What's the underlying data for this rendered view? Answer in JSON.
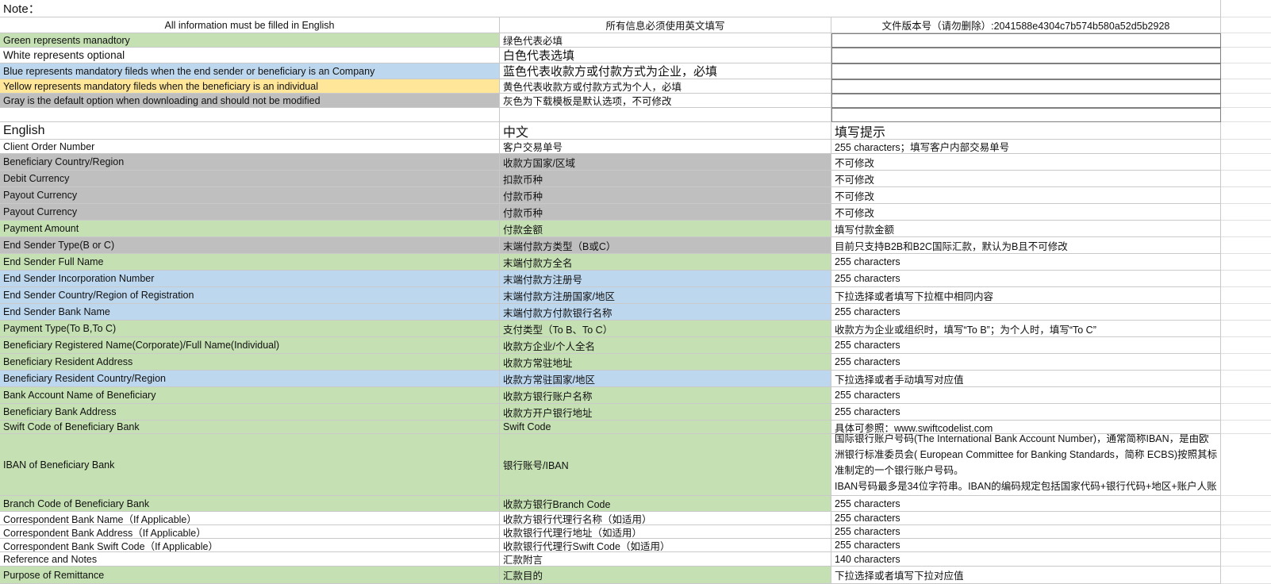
{
  "note": "Note：",
  "header": {
    "english": "All information must be filled in English",
    "chinese": "所有信息必须使用英文填写",
    "version": "文件版本号（请勿删除）:2041588e4304c7b574b580a52d5b2928"
  },
  "legend": [
    {
      "en": "Green represents manadtory",
      "zh": "绿色代表必填"
    },
    {
      "en": "White represents  optional",
      "zh": "白色代表选填"
    },
    {
      "en": "Blue represents mandatory fileds when the end sender or beneficiary is an Company",
      "zh": "蓝色代表收款方或付款方式为企业，必填"
    },
    {
      "en": "Yellow represents mandatory fileds when the beneficiary is an individual",
      "zh": "黄色代表收款方或付款方式为个人，必填"
    },
    {
      "en": "Gray is the default option when downloading and should not be modified",
      "zh": "灰色为下载模板是默认选项，不可修改"
    }
  ],
  "columns": {
    "english": "English",
    "chinese": "中文",
    "hint": "填写提示"
  },
  "fields": [
    {
      "en": "Client Order Number",
      "zh": "客户交易单号",
      "hint": "255 characters；填写客户内部交易单号"
    },
    {
      "en": "Beneficiary Country/Region",
      "zh": "收款方国家/区域",
      "hint": "不可修改"
    },
    {
      "en": "Debit Currency",
      "zh": "扣款币种",
      "hint": "不可修改"
    },
    {
      "en": "Payout Currency",
      "zh": "付款币种",
      "hint": "不可修改"
    },
    {
      "en": "Payout Currency",
      "zh": "付款币种",
      "hint": "不可修改"
    },
    {
      "en": "Payment Amount",
      "zh": "付款金额",
      "hint": "填写付款金额"
    },
    {
      "en": "End Sender Type(B or C)",
      "zh": "末端付款方类型（B或C）",
      "hint": "目前只支持B2B和B2C国际汇款，默认为B且不可修改"
    },
    {
      "en": "End Sender Full Name",
      "zh": "末端付款方全名",
      "hint": "255 characters"
    },
    {
      "en": "End Sender Incorporation Number",
      "zh": "末端付款方注册号",
      "hint": "255 characters"
    },
    {
      "en": "End Sender Country/Region of Registration",
      "zh": "末端付款方注册国家/地区",
      "hint": "下拉选择或者填写下拉框中相同内容"
    },
    {
      "en": "End Sender Bank Name",
      "zh": "末端付款方付款银行名称",
      "hint": "255 characters"
    },
    {
      "en": "Payment Type(To B,To C)",
      "zh": "支付类型（To B、To C）",
      "hint": "收款方为企业或组织时，填写“To B”；为个人时，填写“To C”"
    },
    {
      "en": "Beneficiary Registered Name(Corporate)/Full Name(Individual)",
      "zh": "收款方企业/个人全名",
      "hint": "255 characters"
    },
    {
      "en": "Beneficiary Resident Address",
      "zh": "收款方常驻地址",
      "hint": "255 characters"
    },
    {
      "en": "Beneficiary Resident Country/Region",
      "zh": "收款方常驻国家/地区",
      "hint": "下拉选择或者手动填写对应值"
    },
    {
      "en": "Bank Account Name of Beneficiary",
      "zh": "收款方银行账户名称",
      "hint": "255 characters"
    },
    {
      "en": "Beneficiary Bank Address",
      "zh": "收款方开户银行地址",
      "hint": "255 characters"
    },
    {
      "en": "Swift Code of Beneficiary Bank",
      "zh": "Swift Code",
      "hint": "具体可参照：www.swiftcodelist.com"
    },
    {
      "en": "IBAN of Beneficiary Bank",
      "zh": "银行账号/IBAN",
      "hint_lines": [
        "国际银行账户号码(The International Bank Account Number)，通常简称IBAN，是由欧",
        "洲银行标准委员会( European Committee for Banking Standards，简称 ECBS)按照其标",
        "准制定的一个银行账户号码。",
        "IBAN号码最多是34位字符串。IBAN的编码规定包括国家代码+银行代码+地区+账户人账"
      ]
    },
    {
      "en": "Branch Code of Beneficiary Bank",
      "zh": "收款方银行Branch Code",
      "hint": "255 characters"
    },
    {
      "en": "Correspondent Bank Name（If Applicable）",
      "zh": "收款方银行代理行名称（如适用）",
      "hint": "255 characters"
    },
    {
      "en": "Correspondent Bank Address（If Applicable）",
      "zh": "收款银行代理行地址（如适用）",
      "hint": "255 characters"
    },
    {
      "en": "Correspondent Bank Swift Code（If Applicable）",
      "zh": "收款银行代理行Swift Code（如适用）",
      "hint": "255 characters"
    },
    {
      "en": "Reference and Notes",
      "zh": "汇款附言",
      "hint": "140 characters"
    },
    {
      "en": "Purpose of Remittance",
      "zh": "汇款目的",
      "hint": "下拉选择或者填写下拉对应值"
    }
  ],
  "colors": {
    "green": "#c5e0b3",
    "gray": "#bfbfbf",
    "blue": "#bdd7ee",
    "yellow": "#ffe699",
    "white": "#ffffff"
  }
}
